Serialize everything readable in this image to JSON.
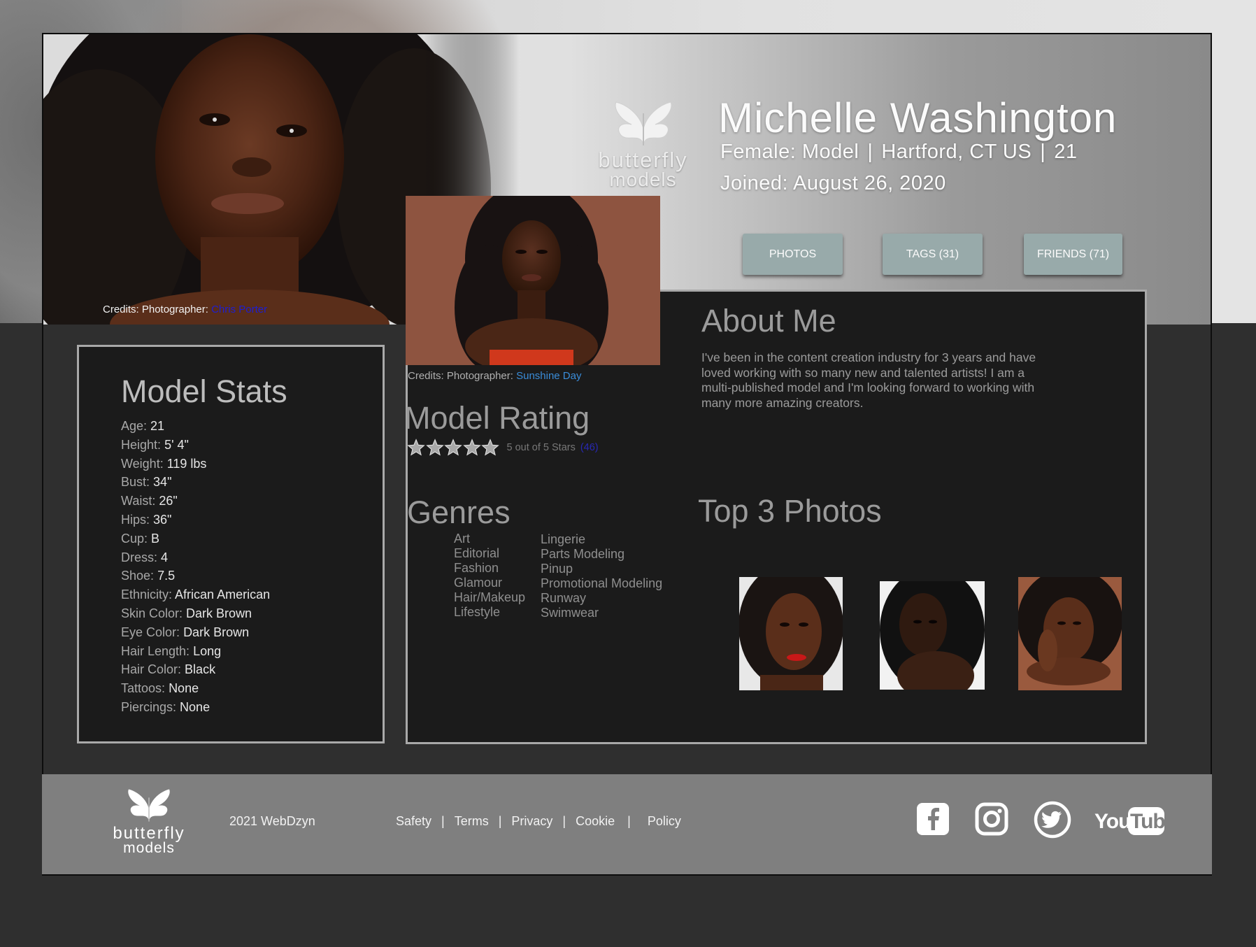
{
  "profile": {
    "name": "Michelle Washington",
    "gender_role": "Female: Model",
    "location": "Hartford, CT US",
    "age": "21",
    "joined": "Joined: August 26, 2020",
    "hero_credit_label": "Credits: Photographer:",
    "hero_credit_name": "Chris Porter"
  },
  "brand": {
    "word1": "butterfly",
    "word2": "models"
  },
  "tabs": [
    {
      "label": "PHOTOS"
    },
    {
      "label": "TAGS (31)"
    },
    {
      "label": "FRIENDS (71)"
    }
  ],
  "stats": {
    "title": "Model Stats",
    "items": [
      {
        "label": "Age:",
        "value": "21"
      },
      {
        "label": "Height:",
        "value": "5' 4\""
      },
      {
        "label": "Weight:",
        "value": "119 lbs"
      },
      {
        "label": "Bust:",
        "value": "34\""
      },
      {
        "label": "Waist:",
        "value": "26\""
      },
      {
        "label": "Hips:",
        "value": "36\""
      },
      {
        "label": "Cup:",
        "value": "B"
      },
      {
        "label": "Dress:",
        "value": "4"
      },
      {
        "label": "Shoe:",
        "value": "7.5"
      },
      {
        "label": "Ethnicity:",
        "value": "African American"
      },
      {
        "label": "Skin Color:",
        "value": "Dark Brown"
      },
      {
        "label": "Eye Color:",
        "value": "Dark Brown"
      },
      {
        "label": "Hair Length:",
        "value": "Long"
      },
      {
        "label": "Hair Color:",
        "value": "Black"
      },
      {
        "label": "Tattoos:",
        "value": "None"
      },
      {
        "label": "Piercings:",
        "value": "None"
      }
    ]
  },
  "photo_credit": {
    "label": "Credits: Photographer:",
    "name": "Sunshine Day"
  },
  "about": {
    "title": "About Me",
    "text": "I've been in the content creation industry for 3 years and have loved working with so many new and talented artists! I am a multi-published model and I'm looking forward to working with many more amazing creators."
  },
  "rating": {
    "title": "Model Rating",
    "stars": 5,
    "text": "5 out of 5 Stars",
    "count": "(46)"
  },
  "genres": {
    "title": "Genres",
    "col1": [
      "Art",
      "Editorial",
      "Fashion",
      "Glamour",
      "Hair/Makeup",
      "Lifestyle"
    ],
    "col2": [
      "Lingerie",
      "Parts Modeling",
      "Pinup",
      "Promotional Modeling",
      "Runway",
      "Swimwear"
    ]
  },
  "top_photos": {
    "title": "Top 3 Photos"
  },
  "footer": {
    "copyright": "2021 WebDzyn",
    "links": [
      "Safety",
      "Terms",
      "Privacy",
      "Cookie",
      "Policy"
    ],
    "social": [
      "facebook-icon",
      "instagram-icon",
      "twitter-icon",
      "youtube-icon"
    ]
  },
  "colors": {
    "tab_bg": "#98aaaa",
    "panel_bg": "#1b1b1b",
    "page_bg": "#2f2f2f",
    "footer_bg": "#7f7f7f",
    "link_blue": "#3a8cd8"
  }
}
